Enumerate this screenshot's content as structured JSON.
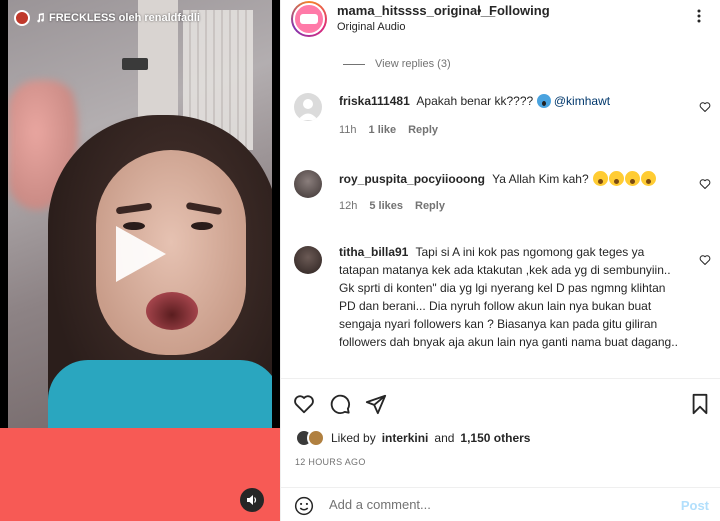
{
  "video": {
    "audio_label": "FRECKLESS oleh renaldfadli"
  },
  "header": {
    "username": "mama_hitssss_original__",
    "separator": "•",
    "follow_state": "Following",
    "subtitle": "Original Audio"
  },
  "replies_toggle": "View replies (3)",
  "comments": [
    {
      "user": "friska111481",
      "text": "Apakah benar kk????",
      "mention": "@kimhawt",
      "time": "11h",
      "likes": "1 like",
      "reply": "Reply"
    },
    {
      "user": "roy_puspita_pocyiiooong",
      "text": "Ya Allah Kim kah?",
      "time": "12h",
      "likes": "5 likes",
      "reply": "Reply"
    },
    {
      "user": "titha_billa91",
      "text": "Tapi si A ini kok pas ngomong gak teges ya tatapan matanya kek ada ktakutan ,kek ada yg di sembunyiin.. Gk sprti di konten\" dia yg lgi nyerang kel D pas ngmng klihtan PD dan berani... Dia nyruh follow akun lain nya bukan buat sengaja nyari followers kan ? Biasanya kan pada gitu giliran followers dah bnyak aja akun lain nya ganti nama buat dagang.."
    }
  ],
  "likes_summary": {
    "prefix": "Liked by",
    "user": "interkini",
    "joiner": "and",
    "others": "1,150 others"
  },
  "post_time": "12 HOURS AGO",
  "add_comment": {
    "placeholder": "Add a comment...",
    "post_label": "Post"
  },
  "colors": {
    "link": "#00376b",
    "muted": "#737373",
    "post_disabled": "#b2dffc",
    "video_band": "#f75a55"
  },
  "icons": [
    "music-note-icon",
    "play-icon",
    "speaker-icon",
    "more-icon",
    "heart-icon",
    "comment-icon",
    "share-icon",
    "bookmark-icon",
    "emoji-icon"
  ]
}
